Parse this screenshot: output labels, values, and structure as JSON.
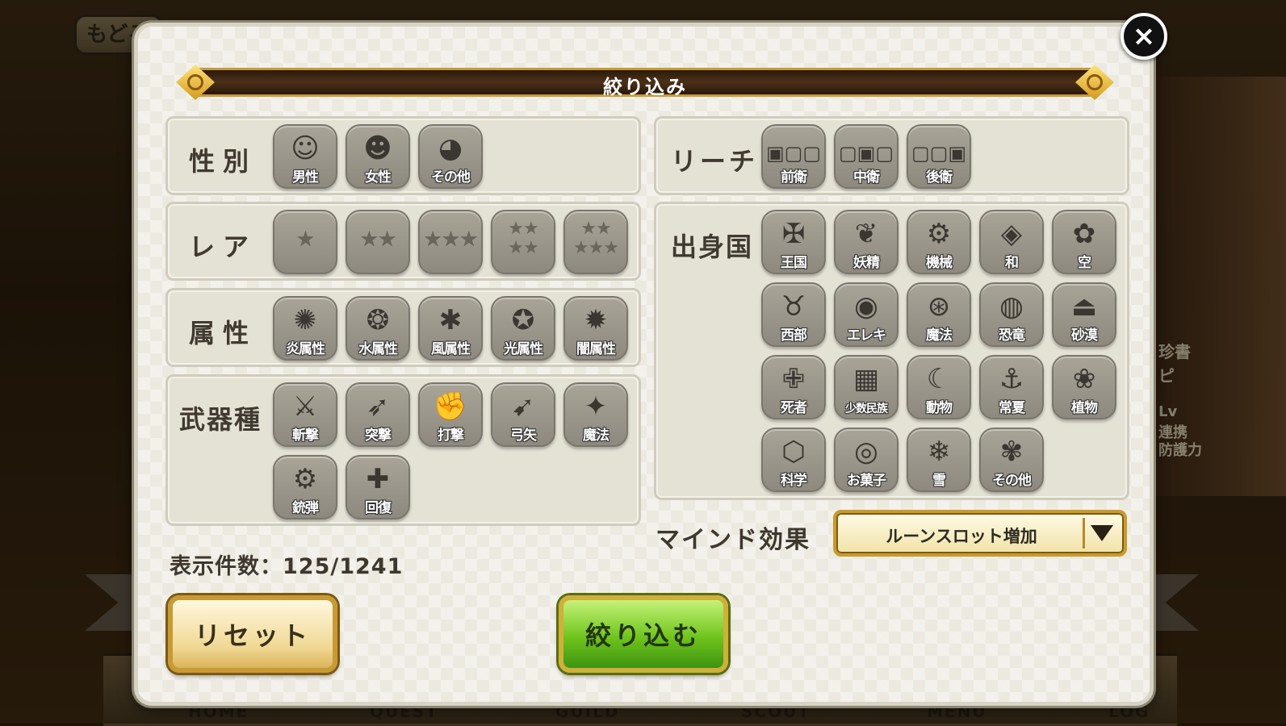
{
  "background": {
    "back_label": "もどる",
    "side_text": [
      "珍書",
      "ピ",
      "Lv",
      "連携",
      "防護力"
    ],
    "nav": [
      "HOME",
      "QUEST",
      "GUILD",
      "SCOUT",
      "MENU",
      "LOG"
    ]
  },
  "modal": {
    "title": "絞り込み",
    "close_icon": "×"
  },
  "sections": {
    "gender": {
      "label": "性別",
      "items": [
        {
          "glyph": "☺",
          "label": "男性"
        },
        {
          "glyph": "☻",
          "label": "女性"
        },
        {
          "glyph": "◕",
          "label": "その他"
        }
      ]
    },
    "rarity": {
      "label": "レア",
      "items": [
        {
          "glyph": "★"
        },
        {
          "glyph": "★★"
        },
        {
          "glyph": "★★★"
        },
        {
          "glyph": "★★\n★★"
        },
        {
          "glyph": "★★\n★★★"
        }
      ]
    },
    "attribute": {
      "label": "属性",
      "items": [
        {
          "glyph": "✺",
          "label": "炎属性"
        },
        {
          "glyph": "❂",
          "label": "水属性"
        },
        {
          "glyph": "✱",
          "label": "風属性"
        },
        {
          "glyph": "✪",
          "label": "光属性"
        },
        {
          "glyph": "✹",
          "label": "闇属性"
        }
      ]
    },
    "weapon": {
      "label": "武器種",
      "items": [
        {
          "glyph": "⚔",
          "label": "斬撃"
        },
        {
          "glyph": "➶",
          "label": "突撃"
        },
        {
          "glyph": "✊",
          "label": "打撃"
        },
        {
          "glyph": "➹",
          "label": "弓矢"
        },
        {
          "glyph": "✦",
          "label": "魔法"
        },
        {
          "glyph": "⚙",
          "label": "銃弾"
        },
        {
          "glyph": "✚",
          "label": "回復"
        }
      ]
    },
    "reach": {
      "label": "リーチ",
      "items": [
        {
          "glyph": "▣▢▢",
          "label": "前衛"
        },
        {
          "glyph": "▢▣▢",
          "label": "中衛"
        },
        {
          "glyph": "▢▢▣",
          "label": "後衛"
        }
      ]
    },
    "origin": {
      "label": "出身国",
      "items": [
        {
          "glyph": "✠",
          "label": "王国"
        },
        {
          "glyph": "❦",
          "label": "妖精"
        },
        {
          "glyph": "⚙",
          "label": "機械"
        },
        {
          "glyph": "◈",
          "label": "和"
        },
        {
          "glyph": "✿",
          "label": "空"
        },
        {
          "glyph": "♉",
          "label": "西部"
        },
        {
          "glyph": "◉",
          "label": "エレキ"
        },
        {
          "glyph": "⊛",
          "label": "魔法"
        },
        {
          "glyph": "◍",
          "label": "恐竜"
        },
        {
          "glyph": "⏏",
          "label": "砂漠"
        },
        {
          "glyph": "✙",
          "label": "死者"
        },
        {
          "glyph": "▦",
          "label": "少数民族"
        },
        {
          "glyph": "☾",
          "label": "動物"
        },
        {
          "glyph": "⚓",
          "label": "常夏"
        },
        {
          "glyph": "❀",
          "label": "植物"
        },
        {
          "glyph": "⬡",
          "label": "科学"
        },
        {
          "glyph": "◎",
          "label": "お菓子"
        },
        {
          "glyph": "❄",
          "label": "雪"
        },
        {
          "glyph": "✾",
          "label": "その他"
        }
      ]
    }
  },
  "count": {
    "label": "表示件数：",
    "value": "125/1241"
  },
  "mind": {
    "label": "マインド効果",
    "selected": "ルーンスロット増加"
  },
  "buttons": {
    "reset": "リセット",
    "apply": "絞り込む"
  }
}
